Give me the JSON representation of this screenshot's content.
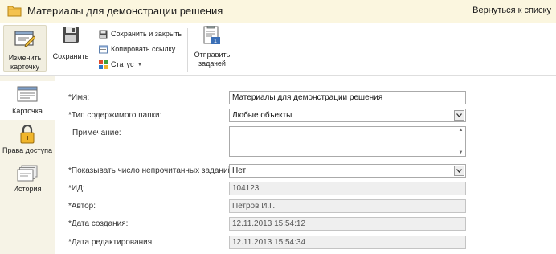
{
  "header": {
    "title": "Материалы для демонстрации решения",
    "back_link": "Вернуться к списку",
    "folder_icon": "folder-icon"
  },
  "toolbar": {
    "edit_card": [
      "Изменить",
      "карточку"
    ],
    "save": "Сохранить",
    "save_and_close": "Сохранить и закрыть",
    "copy_link": "Копировать ссылку",
    "status": "Статус",
    "send_task": [
      "Отправить",
      "задачей"
    ]
  },
  "sidebar": {
    "items": [
      {
        "label": "Карточка",
        "icon": "card-icon",
        "active": true
      },
      {
        "label": "Права доступа",
        "icon": "lock-icon",
        "active": false
      },
      {
        "label": "История",
        "icon": "history-icon",
        "active": false
      }
    ]
  },
  "form": {
    "name_label": "*Имя:",
    "name_value": "Материалы для демонстрации решения",
    "content_type_label": "*Тип содержимого папки:",
    "content_type_value": "Любые объекты",
    "note_label": "Примечание:",
    "note_value": "",
    "unread_label": "*Показывать число непрочитанных заданий:",
    "unread_value": "Нет",
    "id_label": "*ИД:",
    "id_value": "104123",
    "author_label": "*Автор:",
    "author_value": "Петров И.Г.",
    "created_label": "*Дата создания:",
    "created_value": "12.11.2013 15:54:12",
    "modified_label": "*Дата редактирования:",
    "modified_value": "12.11.2013 15:54:34"
  },
  "colors": {
    "header_bg": "#fbf6df",
    "sidebar_bg": "#f6f3e6",
    "readonly_bg": "#efefef"
  }
}
